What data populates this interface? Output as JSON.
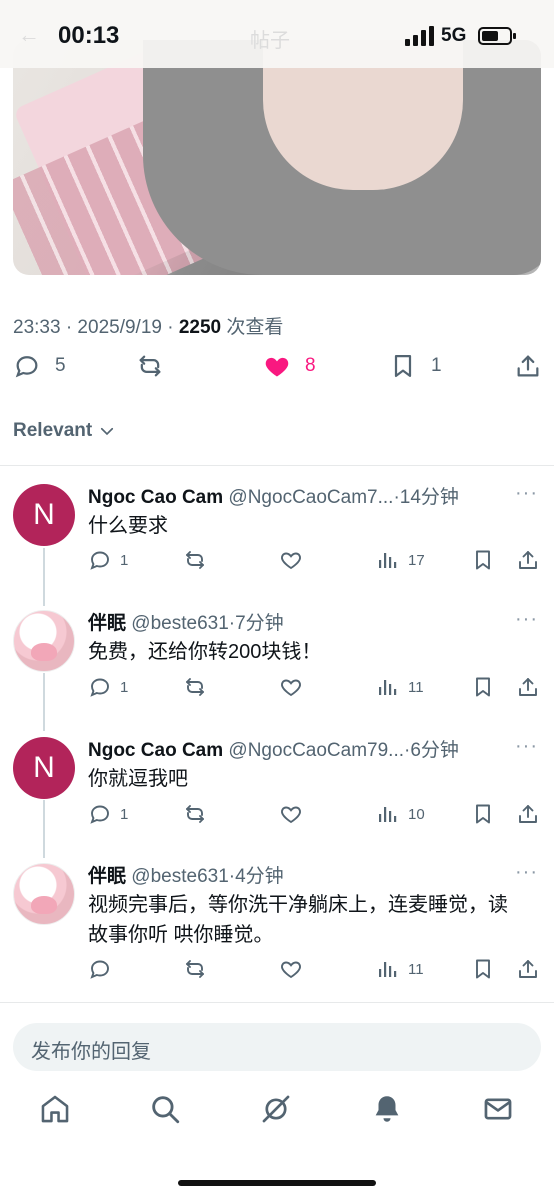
{
  "status_bar": {
    "time": "00:13",
    "network": "5G",
    "ghost_back": "←",
    "ghost_title": "帖子"
  },
  "post": {
    "timestamp": "23:33 · 2025/9/19 · ",
    "views": "2250",
    "views_label": " 次查看",
    "replies_count": "5",
    "reposts_count": "",
    "likes_count": "8",
    "bookmarks_count": "1"
  },
  "sort": {
    "label": "Relevant"
  },
  "replies": [
    {
      "name": "Ngoc Cao Cam",
      "handle": "@NgocCaoCam7...",
      "time": "·14分钟",
      "text": "什么要求",
      "reply_count": "1",
      "views": "17",
      "avatar_letter": "N"
    },
    {
      "name": "伴眠",
      "handle": "@beste631",
      "time": "·7分钟",
      "text": "免费，还给你转200块钱！",
      "reply_count": "1",
      "views": "11",
      "avatar_letter": ""
    },
    {
      "name": "Ngoc Cao Cam",
      "handle": "@NgocCaoCam79...",
      "time": "·6分钟",
      "text": "你就逗我吧",
      "reply_count": "1",
      "views": "10",
      "avatar_letter": "N"
    },
    {
      "name": "伴眠",
      "handle": "@beste631",
      "time": "·4分钟",
      "text": "视频完事后，等你洗干净躺床上，连麦睡觉，读故事你听 哄你睡觉。",
      "reply_count": "",
      "views": "11",
      "avatar_letter": ""
    }
  ],
  "composer": {
    "placeholder": "发布你的回复"
  },
  "more_glyph": "···",
  "colors": {
    "accent_like": "#f91880",
    "avatar_n": "#b2245a",
    "muted_text": "#536471",
    "composer_bg": "#eff3f4"
  },
  "icons": [
    "reply-icon",
    "repost-icon",
    "heart-icon",
    "bookmark-icon",
    "share-icon",
    "views-icon",
    "home-icon",
    "search-icon",
    "grok-icon",
    "bell-icon",
    "mail-icon"
  ]
}
